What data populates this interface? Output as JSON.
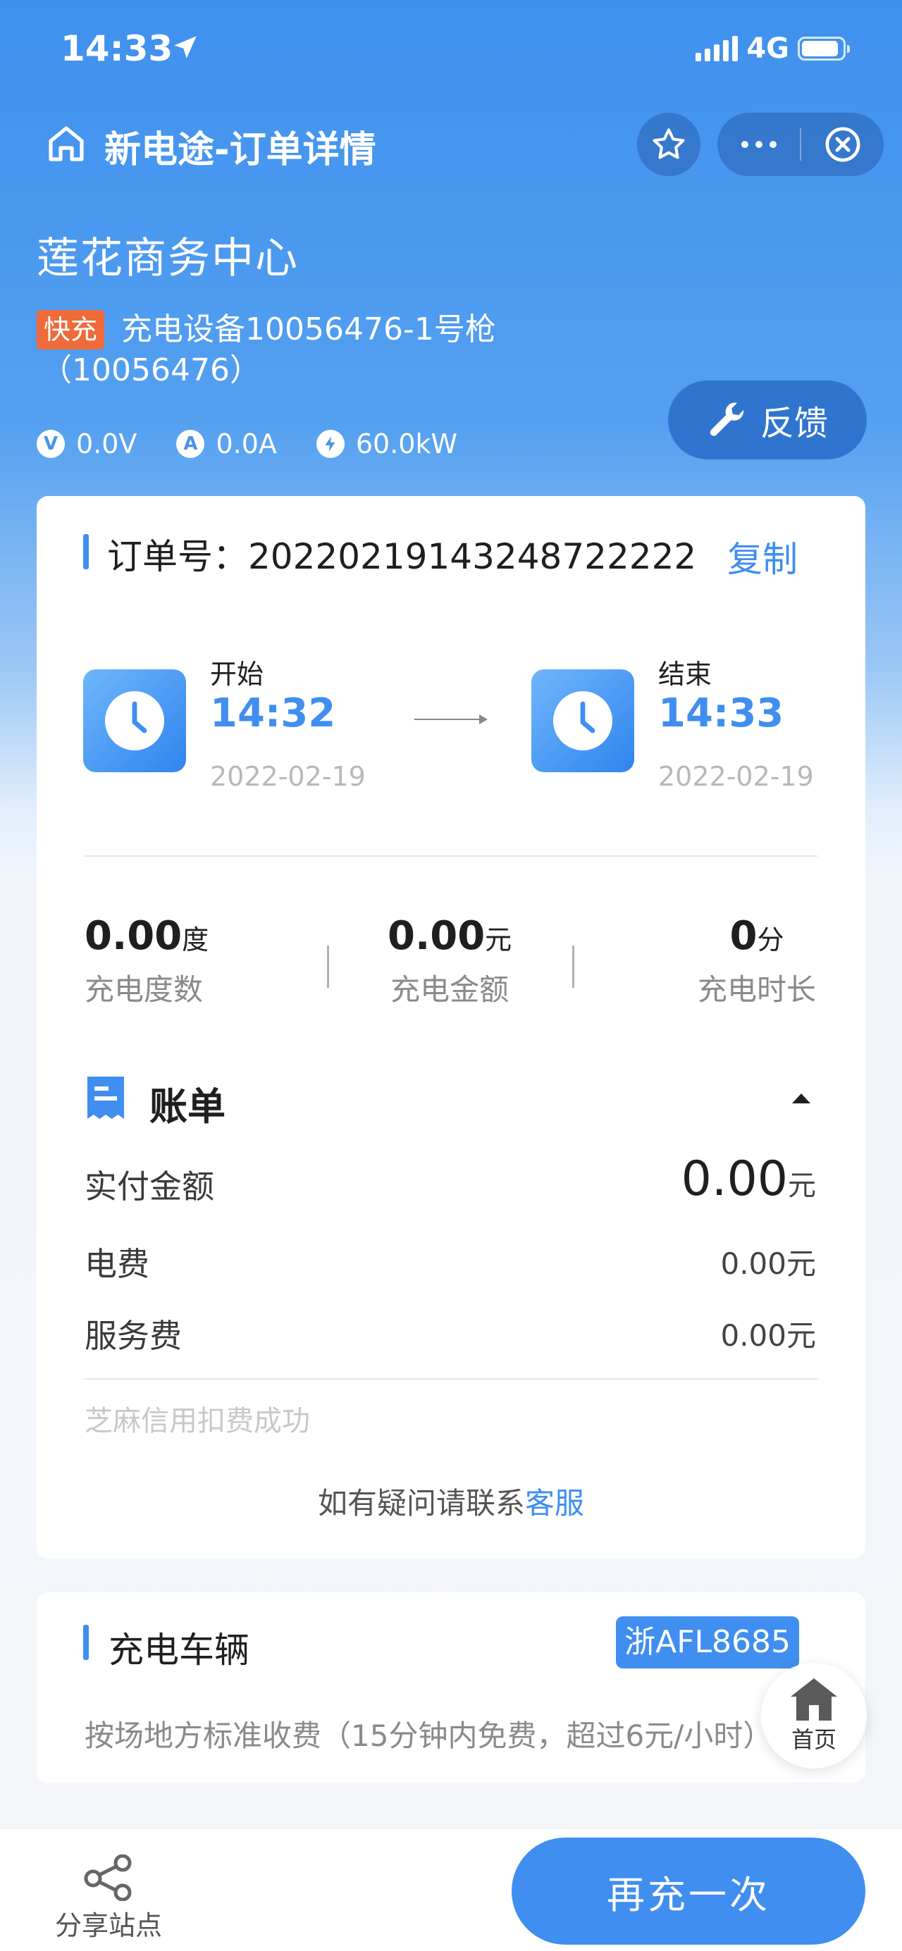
{
  "status_bar": {
    "time": "14:33",
    "network": "4G"
  },
  "nav": {
    "title": "新电途-订单详情"
  },
  "station": {
    "name": "莲花商务中心",
    "charge_type": "快充",
    "device_line1": "充电设备10056476-1号枪",
    "device_line2": "（10056476）",
    "voltage": "0.0V",
    "current": "0.0A",
    "power": "60.0kW",
    "feedback_label": "反馈"
  },
  "order": {
    "label": "订单号：",
    "number": "20220219143248722222",
    "copy_label": "复制"
  },
  "timeline": {
    "start_label": "开始",
    "start_time": "14:32",
    "start_date": "2022-02-19",
    "end_label": "结束",
    "end_time": "14:33",
    "end_date": "2022-02-19"
  },
  "stats": [
    {
      "value": "0.00",
      "unit": "度",
      "label": "充电度数"
    },
    {
      "value": "0.00",
      "unit": "元",
      "label": "充电金额"
    },
    {
      "value": "0",
      "unit": "分",
      "label": "充电时长"
    }
  ],
  "bill": {
    "title": "账单",
    "paid_label": "实付金额",
    "paid_value": "0.00",
    "paid_unit": "元",
    "electricity_label": "电费",
    "electricity_value": "0.00元",
    "service_label": "服务费",
    "service_value": "0.00元",
    "credit_note": "芝麻信用扣费成功",
    "contact_text": "如有疑问请联系",
    "contact_link": "客服"
  },
  "vehicle": {
    "title": "充电车辆",
    "plate": "浙AFL8685",
    "fee_rule": "按场地方标准收费（15分钟内免费，超过6元/小时）"
  },
  "home_fab": {
    "label": "首页"
  },
  "bottom": {
    "share_label": "分享站点",
    "recharge_label": "再充一次"
  },
  "colors": {
    "accent": "#3f8ef0",
    "badge": "#ef6b3a"
  }
}
